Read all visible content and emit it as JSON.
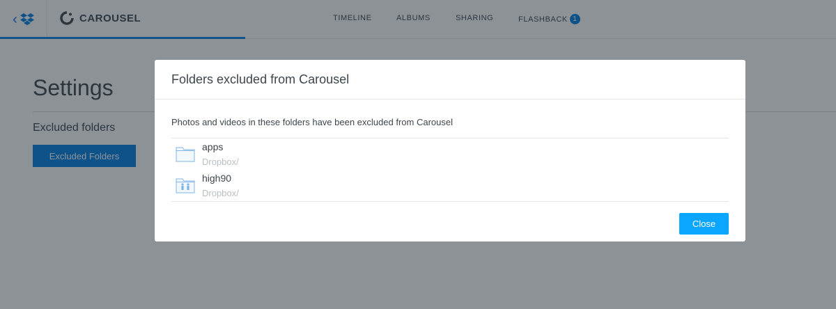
{
  "header": {
    "brand": "CAROUSEL",
    "nav": [
      {
        "label": "TIMELINE"
      },
      {
        "label": "ALBUMS"
      },
      {
        "label": "SHARING"
      },
      {
        "label": "FLASHBACK",
        "badge": "1"
      }
    ],
    "icons": {
      "back": "chevron-left-icon",
      "dropbox": "dropbox-logo-icon",
      "brand": "carousel-logo-icon"
    }
  },
  "settings": {
    "title": "Settings",
    "section_label": "Excluded folders",
    "button_label": "Excluded Folders"
  },
  "modal": {
    "title": "Folders excluded from Carousel",
    "description": "Photos and videos in these folders have been excluded from Carousel",
    "folders": [
      {
        "name": "apps",
        "path": "Dropbox/",
        "icon": "folder-icon"
      },
      {
        "name": "high90",
        "path": "Dropbox/",
        "icon": "shared-folder-icon"
      }
    ],
    "close_label": "Close"
  },
  "colors": {
    "accent": "#007ee5",
    "close_button": "#0aa6ff",
    "overlay": "#1c2530"
  }
}
